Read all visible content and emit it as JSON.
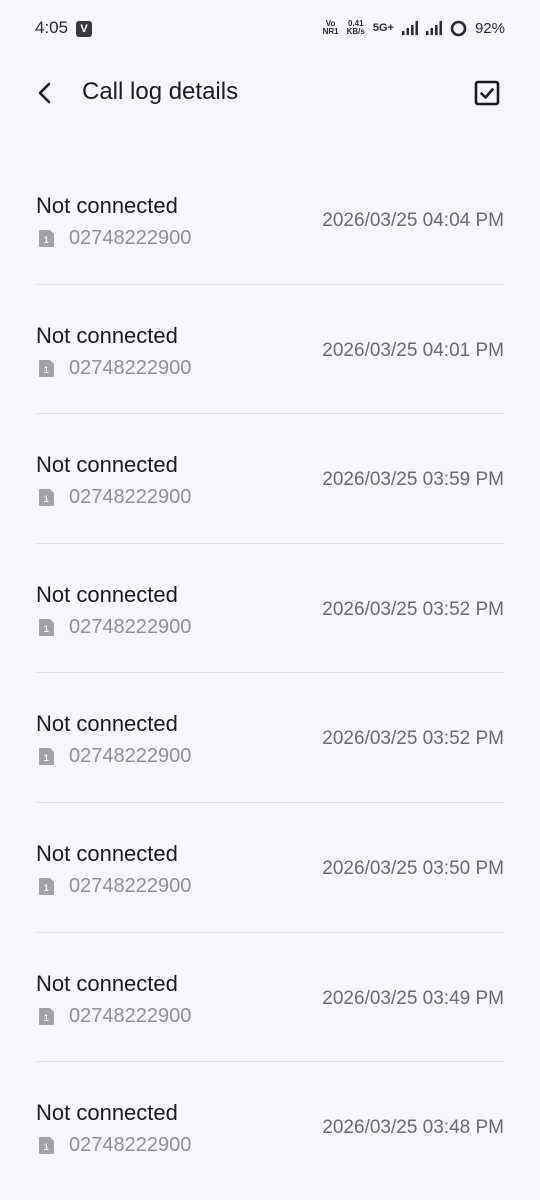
{
  "status_bar": {
    "time": "4:05",
    "carrier_badge": "V",
    "volte_top": "Vo",
    "volte_bottom": "NR1",
    "speed_value": "0.41",
    "speed_unit": "KB/s",
    "network": "5G+",
    "battery": "92%"
  },
  "header": {
    "title": "Call log details",
    "back_icon": "back-arrow-icon",
    "select_icon": "checkbox-icon"
  },
  "calls": [
    {
      "status": "Not connected",
      "sim": "1",
      "number": "02748222900",
      "time": "2026/03/25 04:04 PM"
    },
    {
      "status": "Not connected",
      "sim": "1",
      "number": "02748222900",
      "time": "2026/03/25 04:01 PM"
    },
    {
      "status": "Not connected",
      "sim": "1",
      "number": "02748222900",
      "time": "2026/03/25 03:59 PM"
    },
    {
      "status": "Not connected",
      "sim": "1",
      "number": "02748222900",
      "time": "2026/03/25 03:52 PM"
    },
    {
      "status": "Not connected",
      "sim": "1",
      "number": "02748222900",
      "time": "2026/03/25 03:52 PM"
    },
    {
      "status": "Not connected",
      "sim": "1",
      "number": "02748222900",
      "time": "2026/03/25 03:50 PM"
    },
    {
      "status": "Not connected",
      "sim": "1",
      "number": "02748222900",
      "time": "2026/03/25 03:49 PM"
    },
    {
      "status": "Not connected",
      "sim": "1",
      "number": "02748222900",
      "time": "2026/03/25 03:48 PM"
    }
  ]
}
